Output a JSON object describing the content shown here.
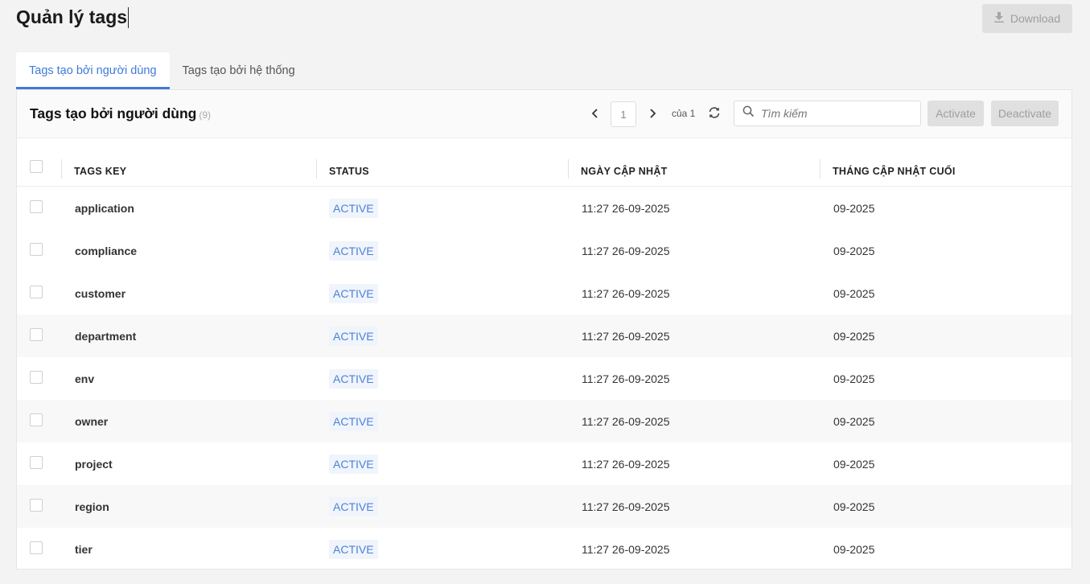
{
  "header": {
    "title": "Quản lý tags",
    "download_label": "Download"
  },
  "tabs": [
    {
      "label": "Tags tạo bởi người dùng",
      "active": true
    },
    {
      "label": "Tags tạo bởi hệ thống",
      "active": false
    }
  ],
  "card": {
    "title": "Tags tạo bởi người dùng",
    "count": "(9)"
  },
  "pagination": {
    "current_page": "1",
    "of_label": "của 1"
  },
  "search": {
    "placeholder": "Tìm kiếm"
  },
  "actions": {
    "activate_label": "Activate",
    "deactivate_label": "Deactivate"
  },
  "table": {
    "columns": [
      "TAGS KEY",
      "STATUS",
      "NGÀY CẬP NHẬT",
      "THÁNG CẬP NHẬT CUỐI"
    ],
    "rows": [
      {
        "key": "application",
        "status": "ACTIVE",
        "updated": "11:27 26-09-2025",
        "month": "09-2025"
      },
      {
        "key": "compliance",
        "status": "ACTIVE",
        "updated": "11:27 26-09-2025",
        "month": "09-2025"
      },
      {
        "key": "customer",
        "status": "ACTIVE",
        "updated": "11:27 26-09-2025",
        "month": "09-2025"
      },
      {
        "key": "department",
        "status": "ACTIVE",
        "updated": "11:27 26-09-2025",
        "month": "09-2025"
      },
      {
        "key": "env",
        "status": "ACTIVE",
        "updated": "11:27 26-09-2025",
        "month": "09-2025"
      },
      {
        "key": "owner",
        "status": "ACTIVE",
        "updated": "11:27 26-09-2025",
        "month": "09-2025"
      },
      {
        "key": "project",
        "status": "ACTIVE",
        "updated": "11:27 26-09-2025",
        "month": "09-2025"
      },
      {
        "key": "region",
        "status": "ACTIVE",
        "updated": "11:27 26-09-2025",
        "month": "09-2025"
      },
      {
        "key": "tier",
        "status": "ACTIVE",
        "updated": "11:27 26-09-2025",
        "month": "09-2025"
      }
    ]
  },
  "colors": {
    "accent": "#3f7bd8",
    "status_text": "#4c82d8",
    "disabled_button_bg": "#e0e0e0",
    "page_bg": "#f3f3f3"
  },
  "icons": {
    "download": "download-icon",
    "prev": "chevron-left-icon",
    "next": "chevron-right-icon",
    "refresh": "refresh-icon",
    "search": "search-icon"
  }
}
